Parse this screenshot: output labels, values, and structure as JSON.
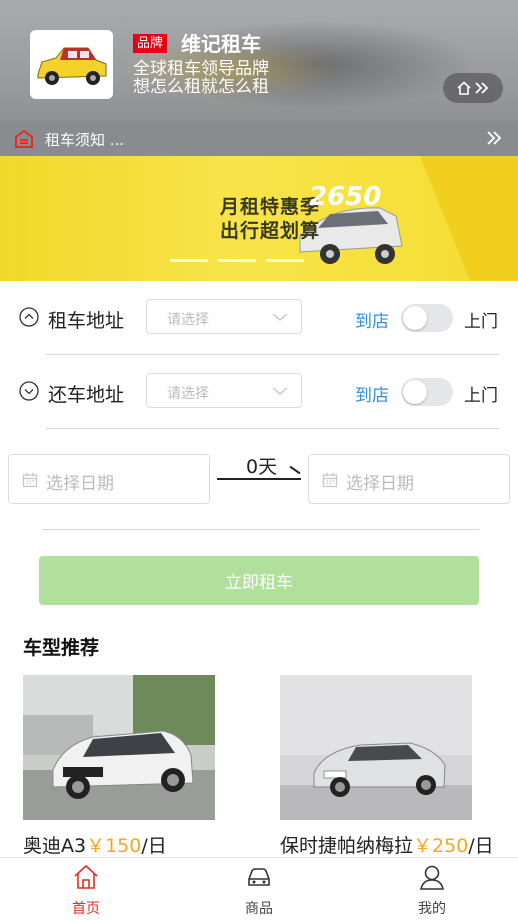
{
  "header": {
    "brand_tag": "品牌",
    "shop_name": "维记租车",
    "slogan_line1": "全球租车领导品牌",
    "slogan_line2": "想怎么租就怎么租",
    "home_icon": "home-icon"
  },
  "notice": {
    "text": "租车须知 ..."
  },
  "banner": {
    "line1": "月租特惠季",
    "line2": "出行超划算",
    "price": "2650",
    "slide_count": 3
  },
  "pickup": {
    "label": "租车地址",
    "placeholder": "请选择",
    "store_label": "到店",
    "door_label": "上门"
  },
  "return": {
    "label": "还车地址",
    "placeholder": "请选择",
    "store_label": "到店",
    "door_label": "上门"
  },
  "dates": {
    "start_placeholder": "选择日期",
    "end_placeholder": "选择日期",
    "days": "0天"
  },
  "rent_button": "立即租车",
  "recommend": {
    "title": "车型推荐",
    "cars": [
      {
        "name": "奥迪A3",
        "price": "￥150",
        "unit": "/日"
      },
      {
        "name": "保时捷帕纳梅拉",
        "price": "￥250",
        "unit": "/日"
      }
    ]
  },
  "tabbar": {
    "items": [
      {
        "label": "首页",
        "icon": "home-icon",
        "active": true
      },
      {
        "label": "商品",
        "icon": "car-icon",
        "active": false
      },
      {
        "label": "我的",
        "icon": "user-icon",
        "active": false
      }
    ]
  },
  "colors": {
    "accent_red": "#e02e24",
    "link_blue": "#2f8fe0",
    "price_orange": "#f5a623",
    "button_green": "#b1e09d"
  }
}
